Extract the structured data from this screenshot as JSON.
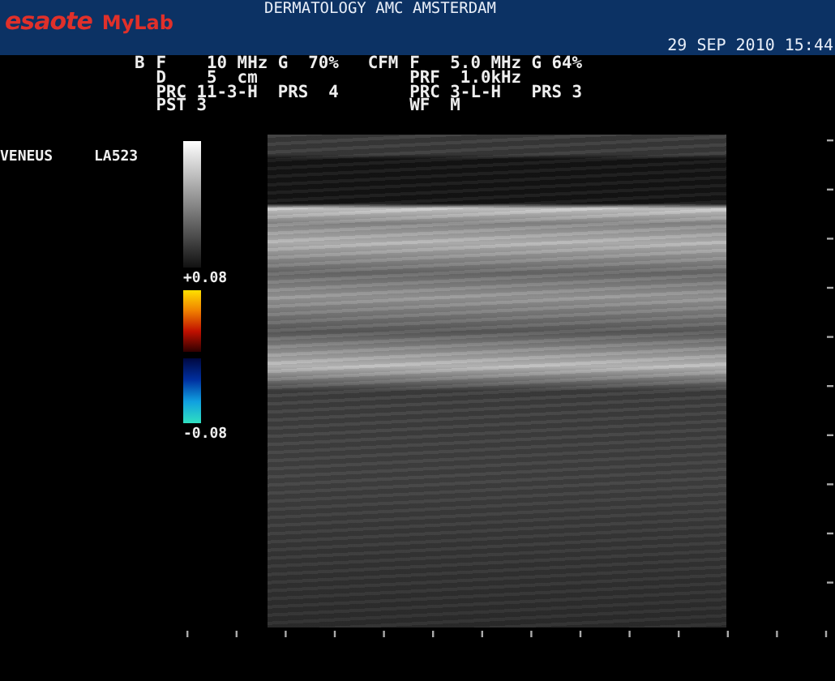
{
  "header": {
    "logo": {
      "brand": "esaote",
      "product": "MyLab"
    },
    "institution": "DERMATOLOGY AMC AMSTERDAM",
    "datetime": "29 SEP 2010 15:44"
  },
  "parameters": [
    {
      "mode": "B",
      "lines": [
        "F    10 MHz G  70%",
        "D    5  cm",
        "PRC 11-3-H  PRS  4",
        "PST 3"
      ]
    },
    {
      "mode": "CFM",
      "lines": [
        "F   5.0 MHz G 64%",
        "PRF  1.0kHz",
        "PRC 3-L-H   PRS 3",
        "WF  M"
      ]
    }
  ],
  "exam": {
    "preset": "VENEUS",
    "probe": "LA523"
  },
  "color_scale": {
    "max": "+0.08",
    "min": "-0.08"
  }
}
